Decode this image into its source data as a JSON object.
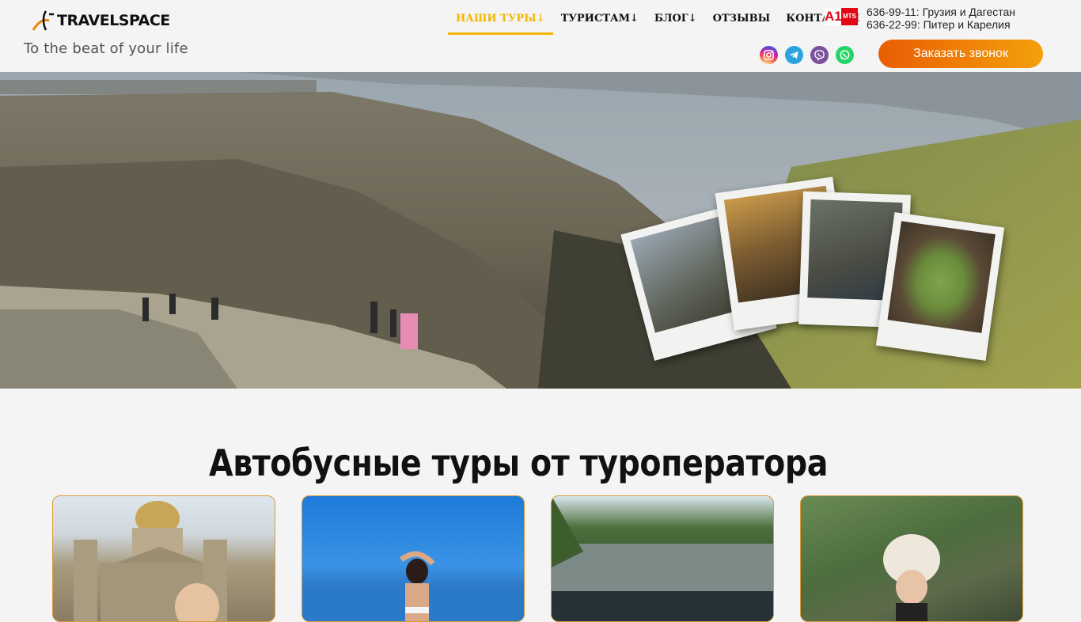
{
  "header": {
    "logo_text": "TRAVELSPACE",
    "tagline": "To the beat of your life",
    "nav": [
      {
        "label": "НАШИ ТУРЫ↓",
        "active": true
      },
      {
        "label": "ТУРИСТАМ↓",
        "active": false
      },
      {
        "label": "БЛОГ↓",
        "active": false
      },
      {
        "label": "ОТЗЫВЫ",
        "active": false
      },
      {
        "label": "КОНТАКТЫ",
        "active": false
      }
    ],
    "operator_logo": {
      "a1": "A1",
      "mts": "MTS"
    },
    "phones": [
      "636-99-11: Грузия и Дагестан",
      "636-22-99: Питер и Карелия"
    ],
    "socials": [
      "instagram-icon",
      "telegram-icon",
      "viber-icon",
      "whatsapp-icon"
    ],
    "callback_button": "Заказать звонок"
  },
  "colors": {
    "accent": "#f2b705",
    "button_start": "#e85d04",
    "button_end": "#f5a00a",
    "card_border": "#d99a3a"
  },
  "main": {
    "section_title": "Автобусные туры от туроператора",
    "cards": [
      {
        "image": "saint-isaacs-cathedral-photo"
      },
      {
        "image": "woman-by-sea-photo"
      },
      {
        "image": "karelia-marble-canyon-photo"
      },
      {
        "image": "woman-in-papakha-mountains-photo"
      }
    ]
  }
}
